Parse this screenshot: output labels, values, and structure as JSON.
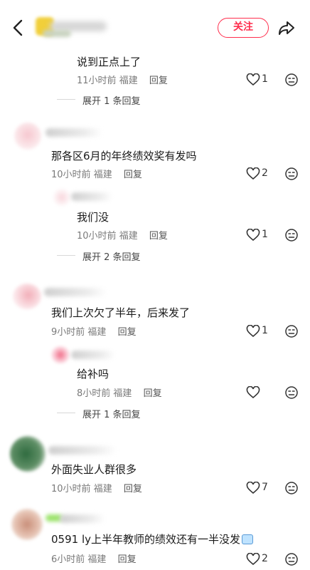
{
  "header": {
    "follow_label": "关注"
  },
  "comments": [
    {
      "text": "说到正点上了",
      "time": "11小时前",
      "location": "福建",
      "reply": "回复",
      "likes": "1",
      "expand": "展开 1 条回复"
    },
    {
      "text": "那各区6月的年终绩效奖有发吗",
      "time": "10小时前",
      "location": "福建",
      "reply": "回复",
      "likes": "2"
    },
    {
      "text": "我们没",
      "time": "10小时前",
      "location": "福建",
      "reply": "回复",
      "likes": "1",
      "expand": "展开 2 条回复"
    },
    {
      "text": "我们上次欠了半年，后来发了",
      "time": "9小时前",
      "location": "福建",
      "reply": "回复",
      "likes": "1"
    },
    {
      "text": "给补吗",
      "time": "8小时前",
      "location": "福建",
      "reply": "回复",
      "likes": "",
      "expand": "展开 1 条回复"
    },
    {
      "text": "外面失业人群很多",
      "time": "10小时前",
      "location": "福建",
      "reply": "回复",
      "likes": "7"
    },
    {
      "text": "0591 ly上半年教师的绩效还有一半没发",
      "time": "6小时前",
      "location": "福建",
      "reply": "回复",
      "likes": "2"
    }
  ],
  "colors": {
    "accent": "#ff2e4d",
    "meta": "#7a7a7a"
  }
}
